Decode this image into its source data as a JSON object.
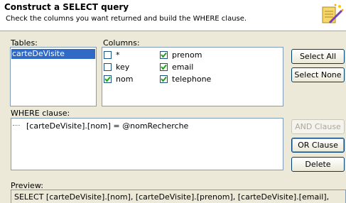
{
  "header": {
    "title": "Construct a SELECT query",
    "subtitle": "Check the columns you want returned and build the WHERE clause."
  },
  "tables": {
    "label": "Tables:",
    "items": [
      "carteDeVisite"
    ]
  },
  "columns": {
    "label": "Columns:",
    "items": [
      {
        "label": "*",
        "checked": false
      },
      {
        "label": "key",
        "checked": false
      },
      {
        "label": "nom",
        "checked": true
      },
      {
        "label": "prenom",
        "checked": true
      },
      {
        "label": "email",
        "checked": true
      },
      {
        "label": "telephone",
        "checked": true
      }
    ]
  },
  "buttons": {
    "select_all": "Select All",
    "select_none": "Select None",
    "and_clause": "AND Clause",
    "or_clause": "OR Clause",
    "delete": "Delete"
  },
  "where": {
    "label": "WHERE clause:",
    "clause": "[carteDeVisite].[nom] = @nomRecherche"
  },
  "preview": {
    "label": "Preview:",
    "text": "SELECT [carteDeVisite].[nom], [carteDeVisite].[prenom], [carteDeVisite].[email],"
  },
  "colors": {
    "selection": "#316ac5",
    "border": "#7f9db9",
    "check": "#21a121"
  }
}
